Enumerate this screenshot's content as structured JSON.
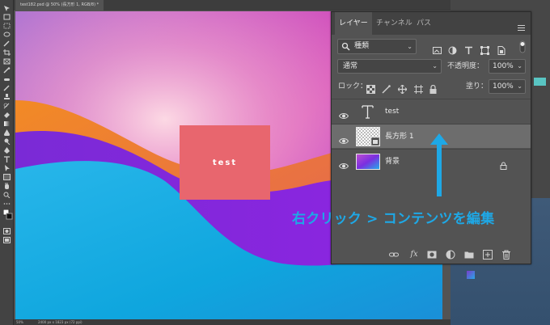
{
  "document": {
    "tab_title": "test182.psd @ 50% (長方形 1, RGB/8) *"
  },
  "canvas": {
    "rect_text": "test"
  },
  "status_bar": {
    "zoom": "50%",
    "size": "2400 px x 1823 px (72 ppi)"
  },
  "layers_panel": {
    "tabs": [
      {
        "label": "レイヤー",
        "active": true
      },
      {
        "label": "チャンネル",
        "active": false
      },
      {
        "label": "パス",
        "active": false
      }
    ],
    "filter": {
      "kind_label": "種類",
      "icons": [
        "pixel-filter-icon",
        "adjustment-filter-icon",
        "type-filter-icon",
        "shape-filter-icon",
        "smartobject-filter-icon"
      ]
    },
    "blend_mode": "通常",
    "opacity_label": "不透明度：",
    "opacity_value": "100%",
    "lock_label": "ロック：",
    "fill_label": "塗り：",
    "fill_value": "100%",
    "layers": [
      {
        "name": "test",
        "type": "text",
        "selected": false,
        "locked": false
      },
      {
        "name": "長方形 1",
        "type": "smart-object",
        "selected": true,
        "locked": false
      },
      {
        "name": "背景",
        "type": "image",
        "selected": false,
        "locked": true
      }
    ],
    "footer_icons": [
      "link-icon",
      "fx-icon",
      "mask-icon",
      "adjustment-icon",
      "group-folder-icon",
      "new-layer-icon",
      "trash-icon"
    ],
    "footer_fx": "fx"
  },
  "annotation": {
    "callout": "右クリック > コンテンツを編集",
    "color": "#1ea8e6"
  },
  "colors": {
    "rect": "#e8666e",
    "panel_bg": "#535353",
    "selected_row": "#6d6d6d"
  }
}
